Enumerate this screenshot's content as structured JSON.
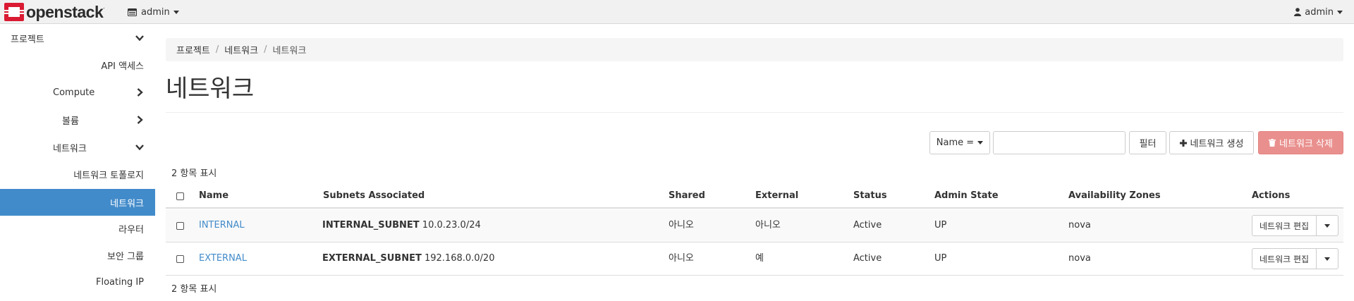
{
  "navbar": {
    "brand": "openstack",
    "brand_mark": ".",
    "project": "admin",
    "user": "admin"
  },
  "sidebar": {
    "items": [
      {
        "label": "프로젝트",
        "icon": "chevron-down-icon"
      },
      {
        "label": "API 액세스"
      },
      {
        "label": "Compute",
        "icon": "chevron-right-icon"
      },
      {
        "label": "볼륨",
        "icon": "chevron-right-icon"
      },
      {
        "label": "네트워크",
        "icon": "chevron-down-icon"
      },
      {
        "label": "네트워크 토폴로지"
      },
      {
        "label": "네트워크",
        "active": true
      },
      {
        "label": "라우터"
      },
      {
        "label": "보안 그룹"
      },
      {
        "label": "Floating IP"
      }
    ]
  },
  "breadcrumb": [
    "프로젝트",
    "네트워크",
    "네트워크"
  ],
  "page_title": "네트워크",
  "toolbar": {
    "filter_field": "Name =",
    "filter_value": "",
    "filter_button": "필터",
    "create_button": "네트워크 생성",
    "delete_button": "네트워크 삭제"
  },
  "count_label": "2 항목 표시",
  "table": {
    "columns": [
      "Name",
      "Subnets Associated",
      "Shared",
      "External",
      "Status",
      "Admin State",
      "Availability Zones",
      "Actions"
    ],
    "rows": [
      {
        "name": "INTERNAL",
        "subnet_name": "INTERNAL_SUBNET",
        "subnet_cidr": "10.0.23.0/24",
        "shared": "아니오",
        "external": "아니오",
        "status": "Active",
        "admin_state": "UP",
        "zones": "nova",
        "action": "네트워크 편집"
      },
      {
        "name": "EXTERNAL",
        "subnet_name": "EXTERNAL_SUBNET",
        "subnet_cidr": "192.168.0.0/20",
        "shared": "아니오",
        "external": "예",
        "status": "Active",
        "admin_state": "UP",
        "zones": "nova",
        "action": "네트워크 편집"
      }
    ]
  },
  "colors": {
    "accent": "#428bca",
    "danger": "#e9908e",
    "logo_red": "#da1a32"
  }
}
